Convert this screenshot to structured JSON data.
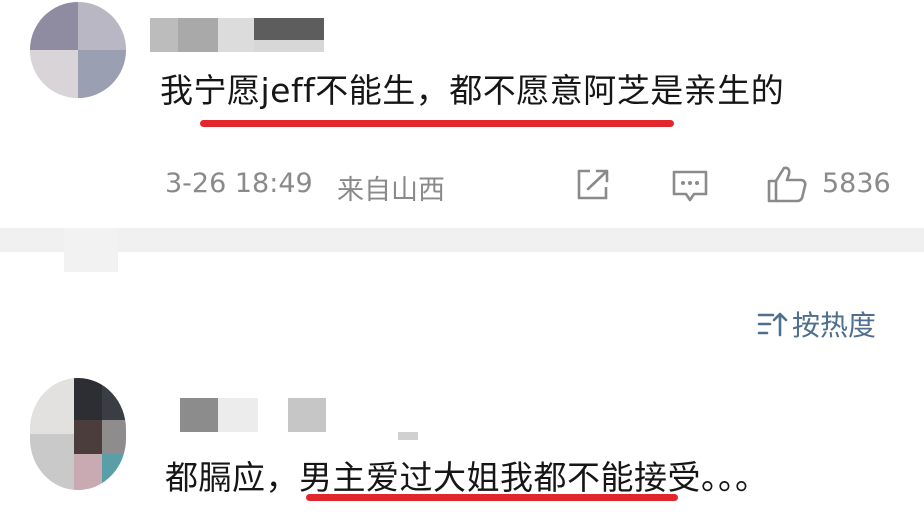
{
  "comments": [
    {
      "text": "我宁愿jeff不能生，都不愿意阿芝是亲生的",
      "date": "3-26 18:49",
      "location": "来自山西",
      "likes": "5836",
      "icons": [
        "share-icon",
        "reply-icon",
        "like-icon"
      ]
    },
    {
      "text_plain": "都膈应，",
      "text_highlight": "男主爱过大姐我都不能接受",
      "text_tail": "。。。"
    }
  ],
  "sort": {
    "label": "按热度",
    "icon": "sort-icon"
  },
  "colors": {
    "highlight_underline": "#e2262e",
    "meta_text": "#8a8a8a",
    "sort_text": "#4f6f8e",
    "divider": "#f0f0f0"
  }
}
